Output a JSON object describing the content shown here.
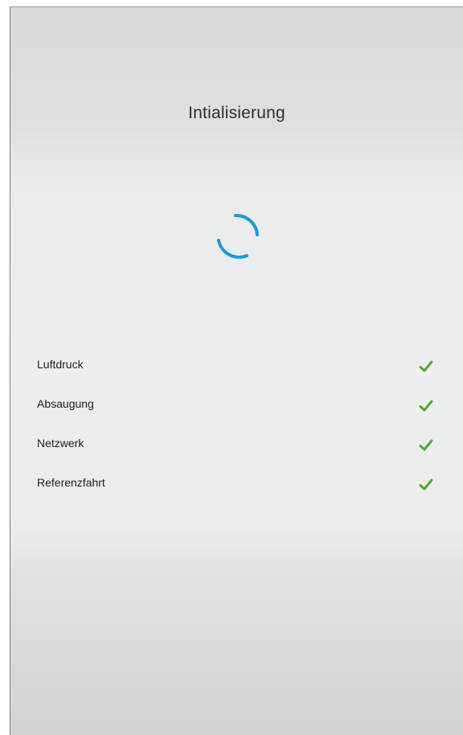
{
  "header": {
    "title": "Intialisierung"
  },
  "spinner": {
    "icon": "loading-spinner-icon",
    "color": "#1a9ad6"
  },
  "status": {
    "check_color": "#54a832",
    "items": [
      {
        "label": "Luftdruck",
        "icon": "check-icon",
        "done": true
      },
      {
        "label": "Absaugung",
        "icon": "check-icon",
        "done": true
      },
      {
        "label": "Netzwerk",
        "icon": "check-icon",
        "done": true
      },
      {
        "label": "Referenzfahrt",
        "icon": "check-icon",
        "done": true
      }
    ]
  }
}
